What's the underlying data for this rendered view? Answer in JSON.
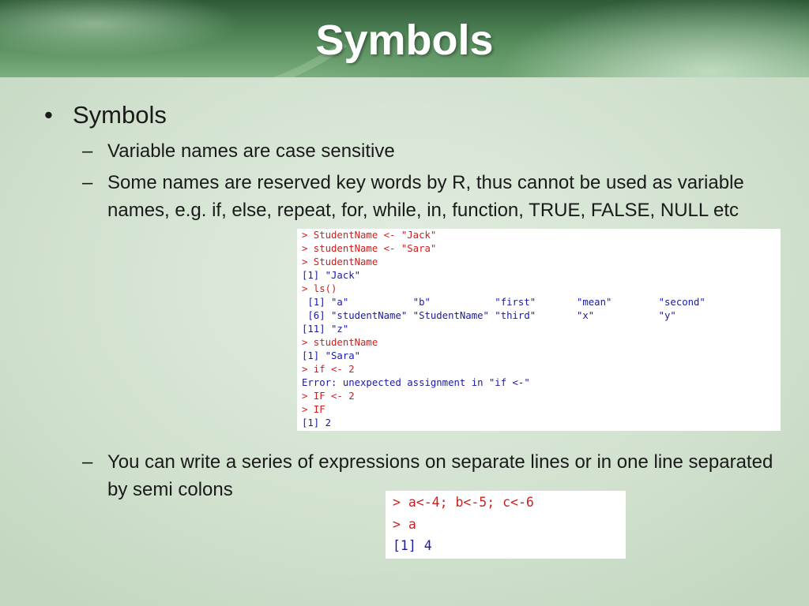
{
  "slide": {
    "title": "Symbols",
    "bullet_main": "Symbols",
    "bullet_char": "•",
    "dash_char": "–",
    "sub_items": [
      "Variable names are case sensitive",
      "Some names are reserved key words by R, thus cannot be used as variable names, e.g. if, else, repeat, for, while, in, function, TRUE, FALSE, NULL etc",
      "You can write a series of expressions on separate lines or in one line separated by semi colons"
    ]
  },
  "console1": {
    "lines": [
      {
        "text": "> StudentName <- \"Jack\"",
        "kind": "cmd"
      },
      {
        "text": "> studentName <- \"Sara\"",
        "kind": "cmd"
      },
      {
        "text": "> StudentName",
        "kind": "cmd"
      },
      {
        "text": "[1] \"Jack\"",
        "kind": "out"
      },
      {
        "text": "> ls()",
        "kind": "cmd"
      },
      {
        "text": " [1] \"a\"           \"b\"           \"first\"       \"mean\"        \"second\"",
        "kind": "out"
      },
      {
        "text": " [6] \"studentName\" \"StudentName\" \"third\"       \"x\"           \"y\"",
        "kind": "out"
      },
      {
        "text": "[11] \"z\"",
        "kind": "out"
      },
      {
        "text": "> studentName",
        "kind": "cmd"
      },
      {
        "text": "[1] \"Sara\"",
        "kind": "out"
      },
      {
        "text": "> if <- 2",
        "kind": "cmd"
      },
      {
        "text": "Error: unexpected assignment in \"if <-\"",
        "kind": "out"
      },
      {
        "text": "> IF <- 2",
        "kind": "cmd"
      },
      {
        "text": "> IF",
        "kind": "cmd"
      },
      {
        "text": "[1] 2",
        "kind": "out"
      }
    ]
  },
  "console2": {
    "lines": [
      {
        "text": "> a<-4; b<-5; c<-6",
        "kind": "cmd"
      },
      {
        "text": "> a",
        "kind": "cmd"
      },
      {
        "text": "[1] 4",
        "kind": "out"
      }
    ]
  },
  "colors": {
    "command": "#cc2020",
    "output": "#1a1aa0",
    "title": "#ffffff"
  }
}
